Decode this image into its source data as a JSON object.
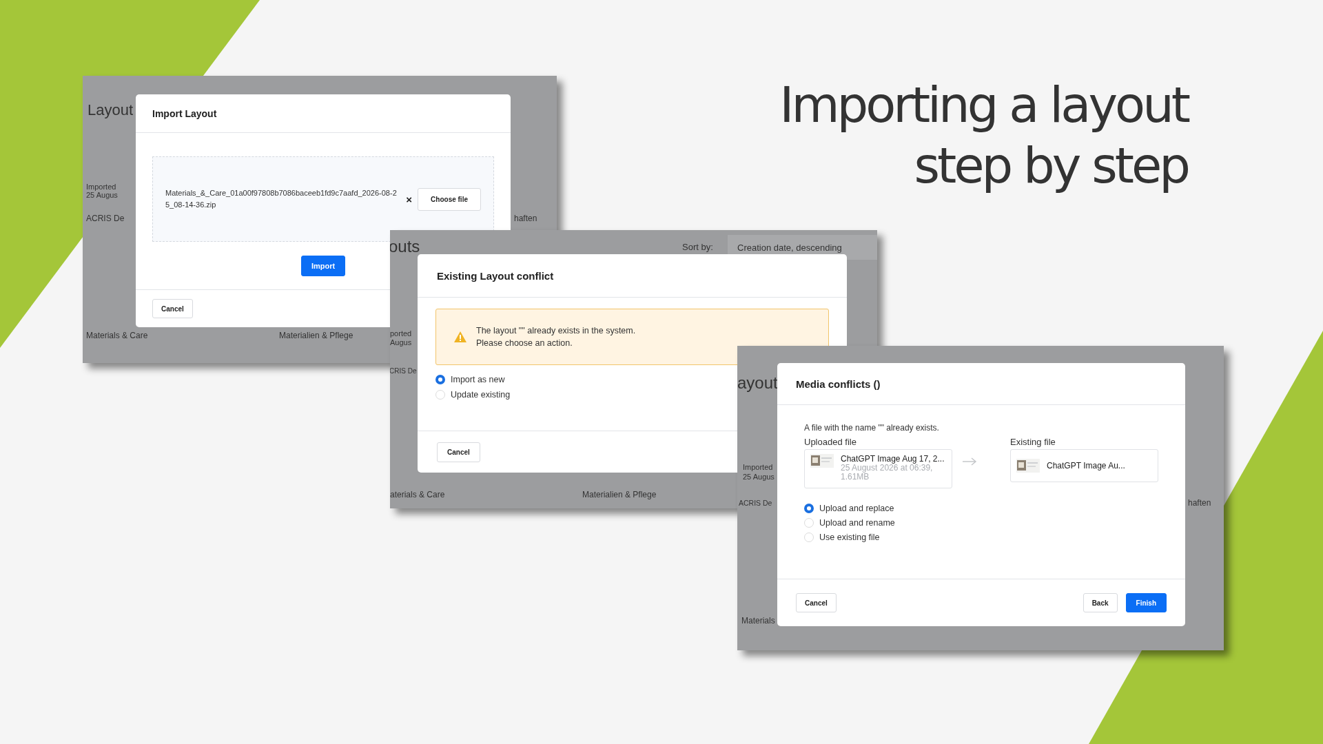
{
  "heading": {
    "lines": [
      "Importing a layout",
      "step by step"
    ]
  },
  "screens": [
    {
      "kind": "import_layout",
      "backdrop": [
        "Layout",
        "Imported",
        "25 Augus",
        "ACRIS De",
        "haften",
        "Materials & Care",
        "Materialien & Pflege"
      ],
      "dialog": {
        "title": "Import Layout",
        "file_name": "Materials_&_Care_01a00f97808b7086baceeb1fd9c7aafd_2026-08-25_08-14-36.zip",
        "clear": "×",
        "choose": "Choose file",
        "primary": "Import",
        "cancel": "Cancel"
      }
    },
    {
      "kind": "layout_conflict",
      "backdrop": [
        "outs",
        "Sort by:",
        "Creation date, descending",
        "ported",
        "Augus",
        "CRIS De",
        "aterials & Care",
        "Materialien & Pflege"
      ],
      "dialog": {
        "title": "Existing Layout conflict",
        "alert": [
          "The layout \"\" already exists in the system.",
          "Please choose an action."
        ],
        "options": [
          {
            "label": "Import as new",
            "selected": true
          },
          {
            "label": "Update existing",
            "selected": false
          }
        ],
        "cancel": "Cancel"
      }
    },
    {
      "kind": "media_conflicts",
      "backdrop": [
        "ayout",
        "Imported",
        "25 Augus",
        "ACRIS De",
        "haften",
        "Materials"
      ],
      "dialog": {
        "title": "Media conflicts ()",
        "message": "A file with the name \"\" already exists.",
        "uploaded": {
          "label": "Uploaded file",
          "name": "ChatGPT Image Aug 17, 2...",
          "meta": [
            "25 August 2026 at 06:39,",
            "1.61MB"
          ]
        },
        "existing": {
          "label": "Existing file",
          "name": "ChatGPT Image Au..."
        },
        "options": [
          {
            "label": "Upload and replace",
            "selected": true
          },
          {
            "label": "Upload and rename",
            "selected": false
          },
          {
            "label": "Use existing file",
            "selected": false
          }
        ],
        "cancel": "Cancel",
        "back": "Back",
        "finish": "Finish"
      }
    }
  ]
}
